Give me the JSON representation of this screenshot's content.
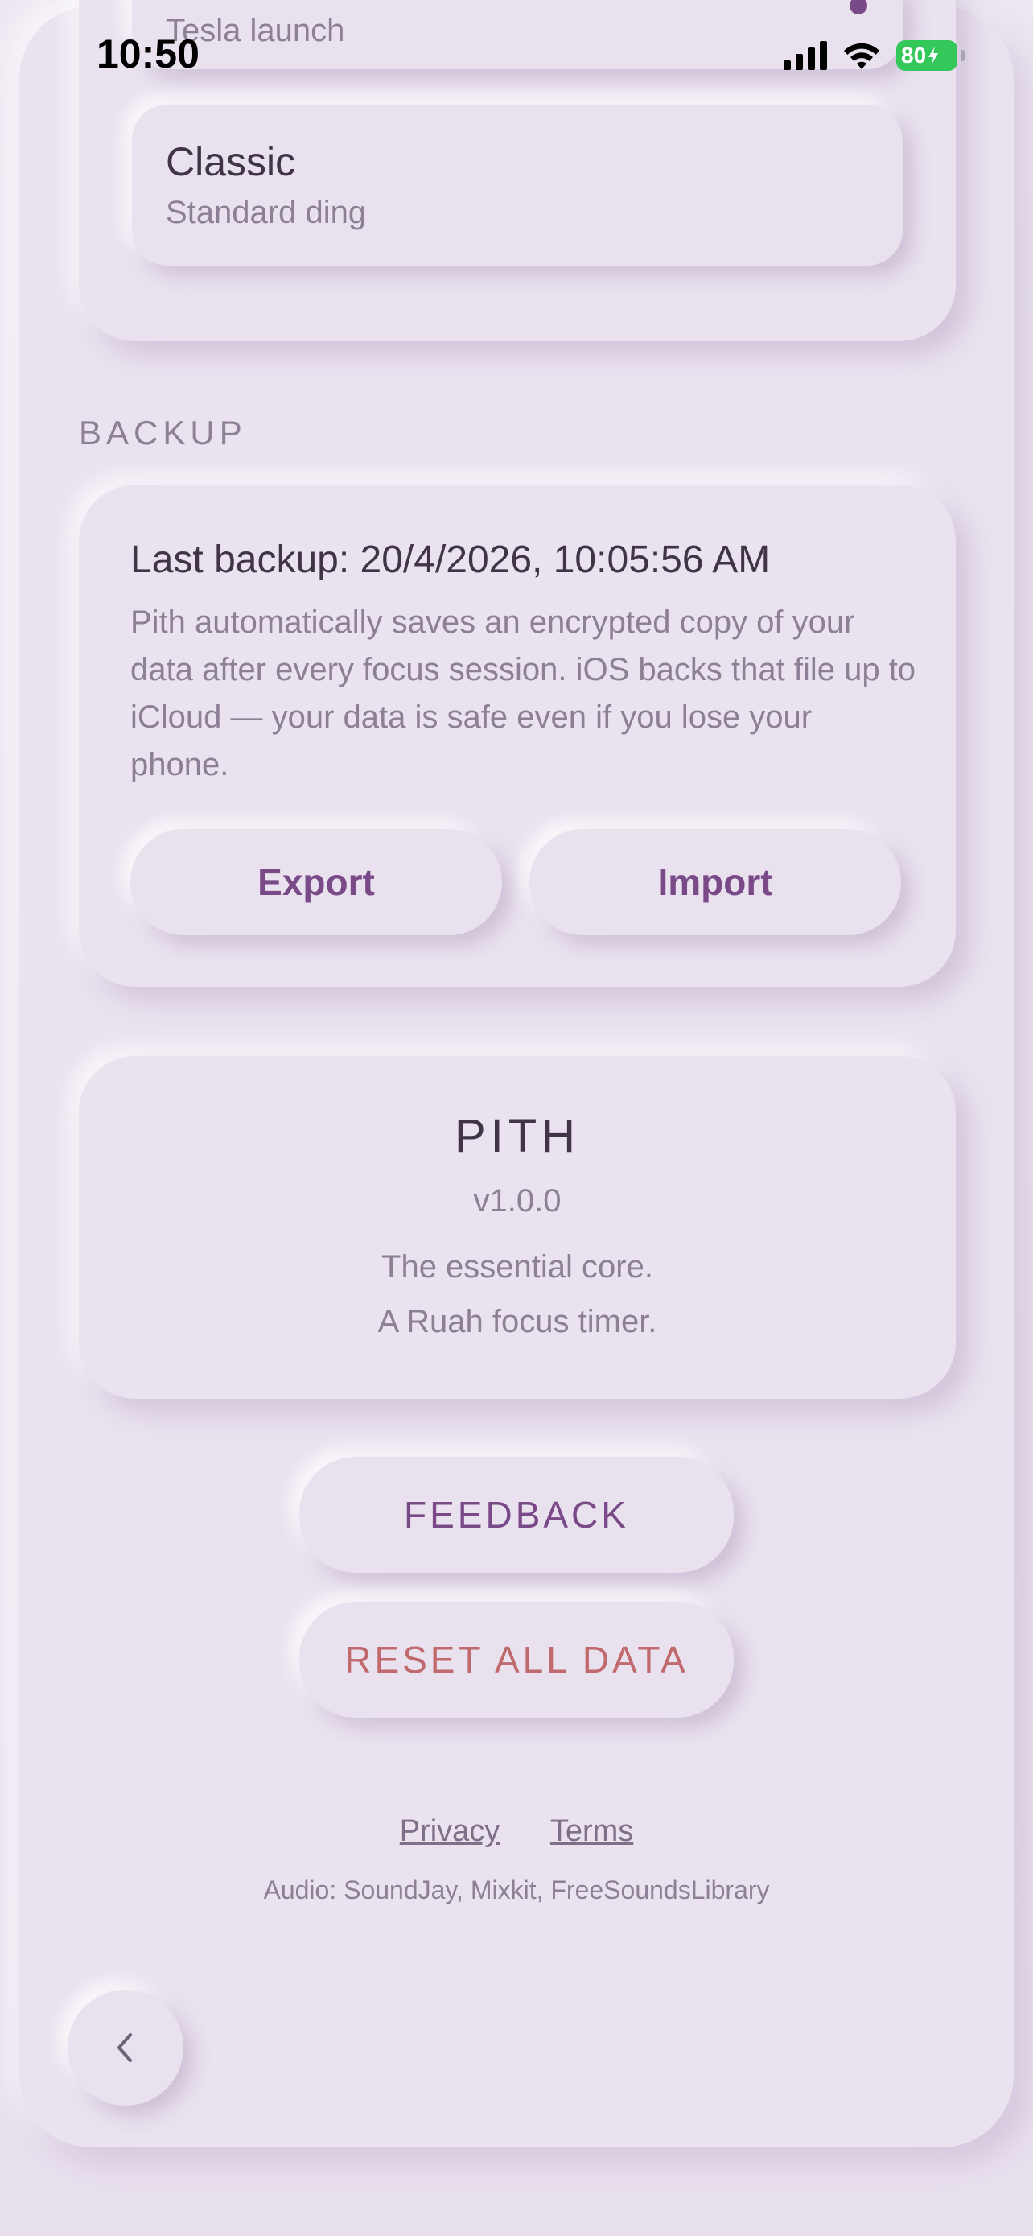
{
  "status_bar": {
    "time": "10:50",
    "battery": "80"
  },
  "sounds": {
    "partial_option_sub": "Tesla launch",
    "classic_title": "Classic",
    "classic_sub": "Standard ding"
  },
  "backup": {
    "section_label": "BACKUP",
    "last_backup": "Last backup: 20/4/2026, 10:05:56 AM",
    "description": "Pith automatically saves an encrypted copy of your data after every focus session. iOS backs that file up to iCloud — your data is safe even if you lose your phone.",
    "export_label": "Export",
    "import_label": "Import"
  },
  "about": {
    "name": "PITH",
    "version": "v1.0.0",
    "tagline_1": "The essential core.",
    "tagline_2": "A Ruah focus timer."
  },
  "actions": {
    "feedback_label": "FEEDBACK",
    "reset_label": "RESET ALL DATA"
  },
  "footer": {
    "privacy_label": "Privacy",
    "terms_label": "Terms",
    "credits": "Audio: SoundJay, Mixkit, FreeSoundsLibrary"
  },
  "colors": {
    "accent": "#7a4a88",
    "danger": "#c06a6e",
    "background": "#eae2ef",
    "battery": "#34c759"
  },
  "icons": {
    "back": "chevron-left-icon",
    "signal": "cellular-signal-icon",
    "wifi": "wifi-icon",
    "battery": "battery-icon"
  }
}
